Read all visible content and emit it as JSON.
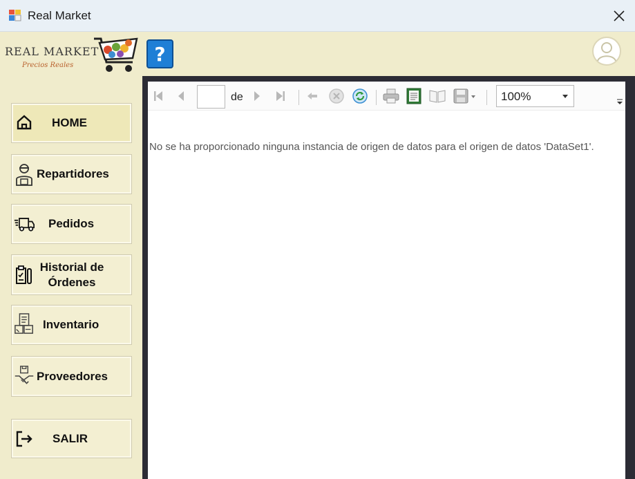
{
  "window": {
    "title": "Real Market"
  },
  "logo": {
    "brand": "REAL MARKET",
    "slogan": "Precios Reales"
  },
  "header": {
    "help_label": "?"
  },
  "sidebar": {
    "items": [
      {
        "label": "HOME",
        "icon": "home-icon",
        "active": true
      },
      {
        "label": "Repartidores",
        "icon": "delivery-person-icon"
      },
      {
        "label": "Pedidos",
        "icon": "truck-icon"
      },
      {
        "label": "Historial de Órdenes",
        "icon": "clipboard-icon"
      },
      {
        "label": "Inventario",
        "icon": "inventory-icon"
      },
      {
        "label": "Proveedores",
        "icon": "handshake-icon"
      },
      {
        "label": "SALIR",
        "icon": "exit-icon"
      }
    ]
  },
  "report": {
    "page_value": "",
    "of_label": "de",
    "zoom": "100%",
    "message": "No se ha proporcionado ninguna instancia de origen de datos para el origen de datos 'DataSet1'."
  }
}
